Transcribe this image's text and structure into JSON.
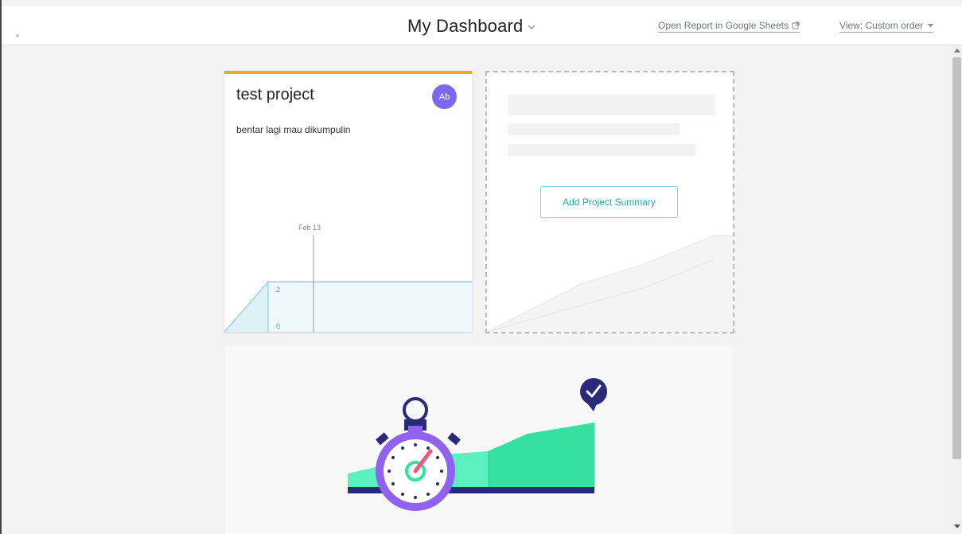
{
  "header": {
    "title": "My Dashboard",
    "report_link": "Open Report in Google Sheets",
    "view_select": "View: Custom order"
  },
  "project_card": {
    "name": "test project",
    "avatar_initials": "Ab",
    "description": "bentar lagi mau dikumpulin",
    "chart": {
      "date_label": "Feb 13",
      "y_top_label": "2",
      "y_bottom_label": "0"
    }
  },
  "summary_card": {
    "button_label": "Add Project Summary"
  },
  "colors": {
    "card_accent": "#f5a623",
    "avatar": "#7b68ee",
    "chart_line": "#7fd1de",
    "button_text": "#2aa5b6",
    "promo_green": "#36e0a0",
    "promo_purple": "#8f63f0",
    "promo_navy": "#2a2a7a"
  }
}
